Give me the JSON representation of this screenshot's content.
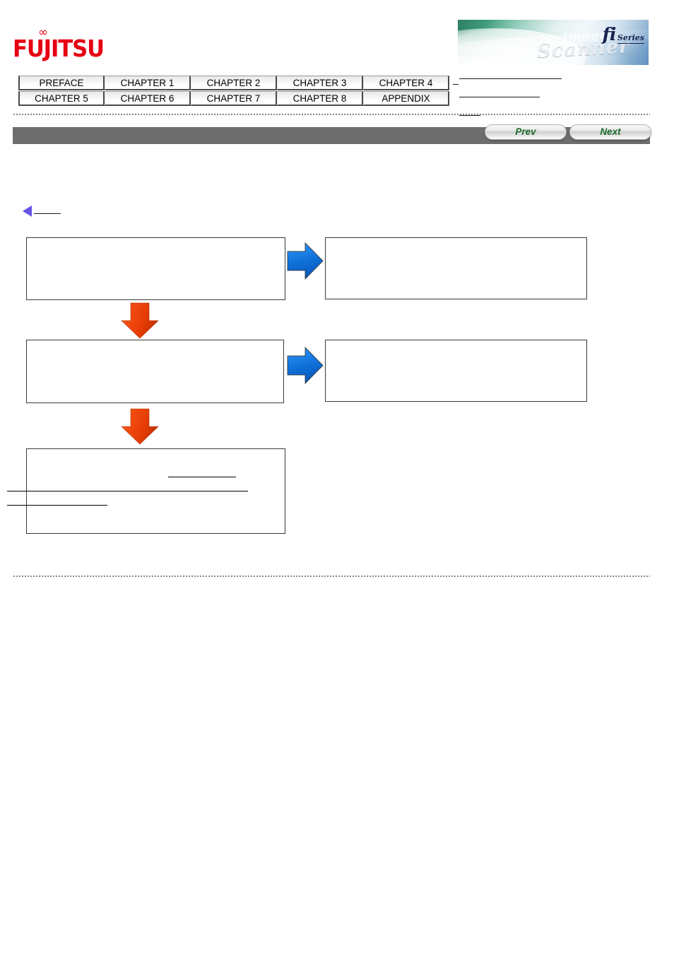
{
  "header": {
    "brand_logo_text": "FUJITSU",
    "brand_logo_mark": "∞",
    "brand_color": "#e60012",
    "banner": {
      "product_mark": "fi",
      "product_series": "Series",
      "word_image": "Image",
      "word_scanner": "Scanner"
    }
  },
  "chapter_nav": {
    "rows": [
      [
        {
          "label": "PREFACE"
        },
        {
          "label": "CHAPTER 1"
        },
        {
          "label": "CHAPTER 2"
        },
        {
          "label": "CHAPTER 3"
        },
        {
          "label": "CHAPTER 4"
        }
      ],
      [
        {
          "label": "CHAPTER 5"
        },
        {
          "label": "CHAPTER 6"
        },
        {
          "label": "CHAPTER 7"
        },
        {
          "label": "CHAPTER 8"
        },
        {
          "label": "APPENDIX"
        }
      ]
    ]
  },
  "header_links": [
    {
      "label": ""
    },
    {
      "label": ""
    },
    {
      "label": ""
    }
  ],
  "nav_bar": {
    "bar_color": "#6d6d6d",
    "prev_label": "Prev",
    "next_label": "Next",
    "link_text_color": "#1d6b2b"
  },
  "back_link": {
    "label": "",
    "marker_color": "#6655e6"
  },
  "flow_diagram": {
    "arrow_right_color": "#1a7fe8",
    "arrow_down_color": "#f1420b",
    "boxes": [
      {
        "id": "flow-box-1",
        "text": ""
      },
      {
        "id": "flow-box-2",
        "text": ""
      },
      {
        "id": "flow-box-3",
        "text": ""
      },
      {
        "id": "flow-box-4",
        "text": ""
      },
      {
        "id": "flow-box-5",
        "text": ""
      }
    ],
    "box5_links": [
      {
        "label": ""
      },
      {
        "label": ""
      },
      {
        "label": ""
      }
    ]
  }
}
